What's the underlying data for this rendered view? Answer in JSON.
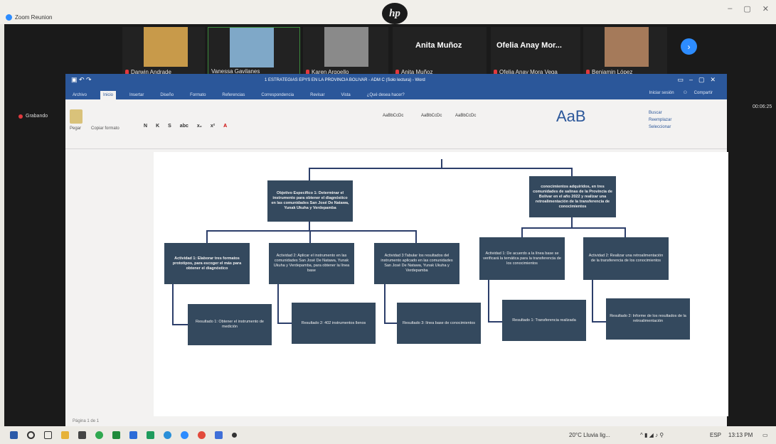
{
  "zoom": {
    "title": "Zoom Reunion",
    "recording": "Grabando",
    "timer": "00:06:25",
    "participants": [
      {
        "name": "Darwin Andrade"
      },
      {
        "name": "Vanessa Gavilanes"
      },
      {
        "name": "Karen Argoello"
      },
      {
        "name": "Anita Muñoz",
        "big": "Anita Muñoz"
      },
      {
        "name": "Ofelia Anay Mora Vega",
        "big": "Ofelia Anay Mor..."
      },
      {
        "name": "Benjamin López"
      }
    ],
    "next_icon": "chevron-right-icon"
  },
  "word": {
    "title": "1 ESTRATEGIAS EPYS EN LA PROVINCIA BOLIVAR - ADM C (Solo lectura) - Word",
    "tabs": [
      "Archivo",
      "Inicio",
      "Insertar",
      "Diseño",
      "Formato",
      "Referencias",
      "Correspondencia",
      "Revisar",
      "Vista",
      "¿Qué desea hacer?"
    ],
    "active_tab": "Inicio",
    "account": "Iniciar sesión",
    "share": "Compartir",
    "paste": "Pegar",
    "copy_format": "Copiar formato",
    "format_buttons": [
      "N",
      "K",
      "S",
      "abc",
      "x₂",
      "x²"
    ],
    "styles": [
      "AaBbCcDc",
      "AaBbCcDc",
      "AaBbCcDc"
    ],
    "style_big": "AaB",
    "ribbon_right": [
      "Buscar",
      "Reemplazar",
      "Seleccionar"
    ],
    "status": "Página 1 de 1"
  },
  "chart": {
    "obj1": "Objetivo Especifico 1: Determinar el instrumento para obtener el diagnóstico en las comunidades San José De Natawa, Yunak Ukuha y Verdepamba",
    "obj2": "conocimientos adquiridos, en tres comunidades de salinas de la Provincia de Bolívar en el año 2022 y realizar una retroalimentación de la transferencia de conocimientos",
    "activities": [
      "Actividad 1: Elaborar tres formatos prototipos, para escoger el más para obtener el diagnóstico",
      "Actividad 2: Aplicar el instrumento en las comunidades San José De Natawa, Yunak Ukuha y Verdepamba, para obtener la línea base",
      "Actividad 3:Tabular los resultados del instrumento aplicado en las comunidades San José De Natawa, Yunak Ukuha y Verdepamba",
      "Actividad 1: De acuerdo a la línea base se verificará la temática para la transferencia de los conocimientos",
      "Actividad 2: Realizar una retroalimentación de la transferencia de los conocimientos"
    ],
    "results": [
      "Resultado 1: Obtener el instrumento de medición",
      "Resultado 2: 402 instrumentos llenos",
      "Resultado 3: línea base de conocimientos",
      "Resultado 1: Transferencia realizada",
      "Resultado 2: Informe de los resultados de la retroalimentación"
    ]
  },
  "taskbar": {
    "weather": "20°C  Lluvia lig...",
    "lang": "ESP",
    "time": "13:13 PM"
  }
}
